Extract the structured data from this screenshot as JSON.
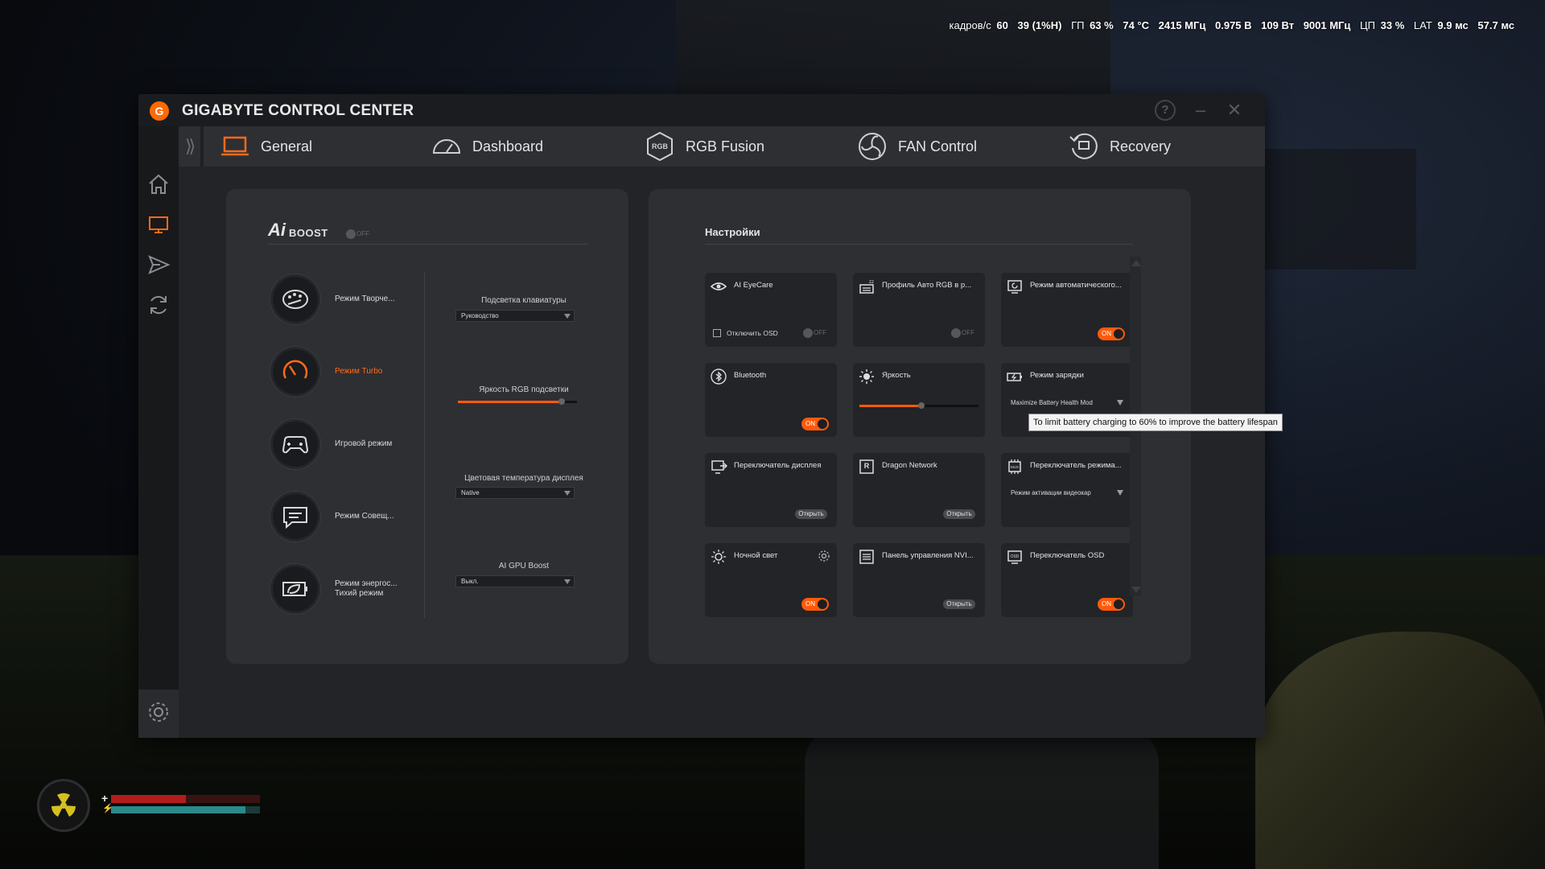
{
  "overlay": {
    "fps_label": "кадров/с",
    "fps_value": "60",
    "fps_low": "39 (1%Н)",
    "gpu_label": "ГП",
    "gpu_load": "63 %",
    "gpu_temp": "74 °C",
    "gpu_clock": "2415 МГц",
    "gpu_voltage": "0.975 В",
    "gpu_power": "109 Вт",
    "mem_clock": "9001 МГц",
    "cpu_label": "ЦП",
    "cpu_load": "33 %",
    "lat_label": "LAT",
    "lat_value": "9.9 мс",
    "frametime": "57.7 мс"
  },
  "window": {
    "title": "GIGABYTE CONTROL CENTER",
    "logo_letter": "G"
  },
  "tabs": [
    {
      "label": "General",
      "icon": "laptop-icon",
      "active": true
    },
    {
      "label": "Dashboard",
      "icon": "speedometer-icon"
    },
    {
      "label": "RGB Fusion",
      "icon": "rgb-fusion-icon",
      "icon_text": "RGB"
    },
    {
      "label": "FAN Control",
      "icon": "fan-icon"
    },
    {
      "label": "Recovery",
      "icon": "recovery-icon"
    }
  ],
  "sidebar": [
    "home-icon",
    "monitor-icon",
    "send-icon",
    "refresh-icon",
    "gear-icon"
  ],
  "ai_boost": {
    "logo": "Ai",
    "label": "BOOST",
    "toggle": "OFF"
  },
  "modes": [
    {
      "label": "Режим Творче...",
      "icon": "palette-icon"
    },
    {
      "label": "Режим Turbo",
      "icon": "turbo-icon",
      "active": true
    },
    {
      "label": "Игровой режим",
      "icon": "gamepad-icon"
    },
    {
      "label": "Режим Совещ...",
      "icon": "meeting-icon"
    },
    {
      "label": "Режим энергос...",
      "label2": "Тихий режим",
      "icon": "battery-leaf-icon"
    }
  ],
  "controls": {
    "keyboard_backlight": {
      "label": "Подсветка клавиатуры",
      "value": "Руководство"
    },
    "rgb_brightness": {
      "label": "Яркость RGB подсветки",
      "level": 0.87
    },
    "color_temp": {
      "label": "Цветовая температура дисплея",
      "value": "Native"
    },
    "gpu_boost": {
      "label": "AI GPU Boost",
      "value": "Выкл."
    }
  },
  "settings": {
    "title": "Настройки",
    "cards": [
      {
        "title": "AI EyeCare",
        "icon": "eye-icon",
        "checkbox": "Отключить OSD",
        "toggle": "OFF"
      },
      {
        "title": "Профиль Авто RGB в р...",
        "icon": "keyboard-zz-icon",
        "toggle": "OFF"
      },
      {
        "title": "Режим автоматического...",
        "icon": "display-refresh-icon",
        "toggle": "ON"
      },
      {
        "title": "Bluetooth",
        "icon": "bluetooth-icon",
        "toggle": "ON"
      },
      {
        "title": "Яркость",
        "icon": "sun-icon",
        "brightness": 0.52
      },
      {
        "title": "Режим зарядки",
        "icon": "battery-charge-icon",
        "select": "Maximize Battery Health Mod"
      },
      {
        "title": "Переключатель дисплея",
        "icon": "display-switch-icon",
        "button": "Открыть"
      },
      {
        "title": "Dragon Network",
        "icon": "dragon-network-icon",
        "icon_text": "R",
        "button": "Открыть"
      },
      {
        "title": "Переключатель режима...",
        "icon": "mux-chip-icon",
        "icon_text": "MUX",
        "select": "Режим активации видеокар"
      },
      {
        "title": "Ночной свет",
        "icon": "night-light-icon",
        "toggle": "ON",
        "gear": true
      },
      {
        "title": "Панель управления NVI...",
        "icon": "nvidia-panel-icon",
        "button": "Открыть"
      },
      {
        "title": "Переключатель OSD",
        "icon": "osd-icon",
        "icon_text": "OSD",
        "toggle": "ON"
      }
    ]
  },
  "tooltip": "To limit battery charging to 60% to improve the battery lifespan",
  "hud": {
    "health": 0.5,
    "stamina": 0.9
  }
}
